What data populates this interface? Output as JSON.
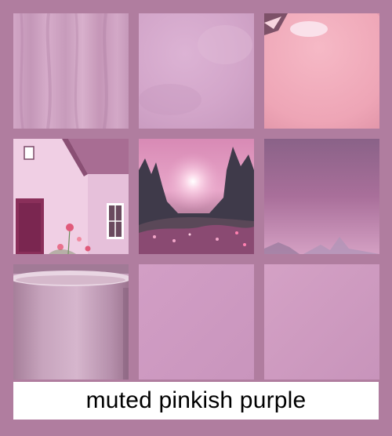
{
  "caption": "muted pinkish purple",
  "colors": {
    "background": "#b07d9f",
    "caption_bg": "#ffffff",
    "caption_text": "#000000"
  },
  "tiles": [
    {
      "name": "draped-fabric"
    },
    {
      "name": "watercolor-paper"
    },
    {
      "name": "glossy-sphere"
    },
    {
      "name": "pink-cottage"
    },
    {
      "name": "misty-forest-sunrise"
    },
    {
      "name": "purple-sky-mountains"
    },
    {
      "name": "ceramic-mug"
    },
    {
      "name": "flat-pink-swatch"
    },
    {
      "name": "flat-mauve-swatch"
    }
  ]
}
